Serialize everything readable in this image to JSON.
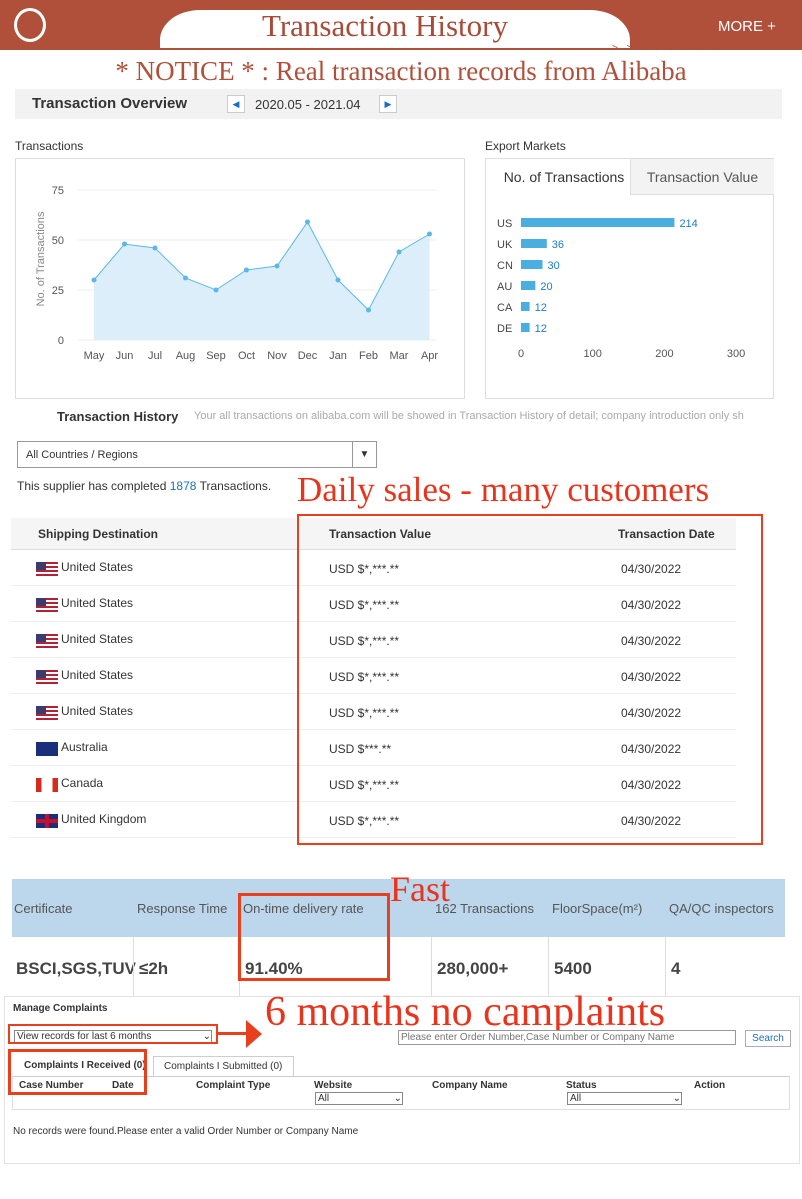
{
  "header": {
    "title": "Transaction History",
    "more": "MORE +",
    "arrows_left": "< < < < < < < < < <",
    "arrows_right": "> > > > > > > >"
  },
  "notice": "* NOTICE * : Real transaction records from Alibaba",
  "overview": {
    "title": "Transaction Overview",
    "range": "2020.05 - 2021.04"
  },
  "chart_data": [
    {
      "type": "area",
      "title": "Transactions",
      "ylabel": "No. of Transactions",
      "ylim": [
        0,
        75
      ],
      "yticks": [
        "0",
        "25",
        "50",
        "75"
      ],
      "categories": [
        "May",
        "Jun",
        "Jul",
        "Aug",
        "Sep",
        "Oct",
        "Nov",
        "Dec",
        "Jan",
        "Feb",
        "Mar",
        "Apr"
      ],
      "values": [
        30,
        48,
        46,
        31,
        25,
        35,
        37,
        59,
        30,
        15,
        44,
        53
      ],
      "color": "#5bb8e6"
    },
    {
      "type": "bar",
      "title": "Export Markets",
      "tabs": [
        "No. of Transactions",
        "Transaction Value"
      ],
      "categories": [
        "US",
        "UK",
        "CN",
        "AU",
        "CA",
        "DE"
      ],
      "values": [
        214,
        36,
        30,
        20,
        12,
        12
      ],
      "xlim": [
        0,
        300
      ],
      "xticks": [
        "0",
        "100",
        "200",
        "300"
      ],
      "color": "#4aaee0"
    }
  ],
  "history": {
    "title": "Transaction History",
    "desc": "Your all transactions on alibaba.com will be showed in Transaction History of detail; company introduction only sh",
    "filter": "All Countries / Regions",
    "completed_pre": "This supplier has completed ",
    "completed_count": "1878",
    "completed_post": " Transactions."
  },
  "annotations": {
    "daily": "Daily sales - many customers",
    "fast": "Fast",
    "no_complaints": "6 months no camplaints"
  },
  "table": {
    "headers": [
      "Shipping Destination",
      "Transaction Value",
      "Transaction Date"
    ],
    "rows": [
      {
        "country": "United States",
        "flag": "us",
        "value": "USD $*,***.**",
        "date": "04/30/2022"
      },
      {
        "country": "United States",
        "flag": "us",
        "value": "USD $*,***.**",
        "date": "04/30/2022"
      },
      {
        "country": "United States",
        "flag": "us",
        "value": "USD $*,***.**",
        "date": "04/30/2022"
      },
      {
        "country": "United States",
        "flag": "us",
        "value": "USD $*,***.**",
        "date": "04/30/2022"
      },
      {
        "country": "United States",
        "flag": "us",
        "value": "USD $*,***.**",
        "date": "04/30/2022"
      },
      {
        "country": "Australia",
        "flag": "au",
        "value": "USD $***.**",
        "date": "04/30/2022"
      },
      {
        "country": "Canada",
        "flag": "ca",
        "value": "USD $*,***.**",
        "date": "04/30/2022"
      },
      {
        "country": "United Kingdom",
        "flag": "uk",
        "value": "USD $*,***.**",
        "date": "04/30/2022"
      }
    ]
  },
  "stats": {
    "headers": [
      "Certificate",
      "Response Time",
      "On-time delivery rate",
      "162 Transactions",
      "FloorSpace(m²)",
      "QA/QC inspectors"
    ],
    "values": [
      "BSCI,SGS,TUV",
      "≤2h",
      "91.40%",
      "280,000+",
      "5400",
      "4"
    ]
  },
  "complaints": {
    "title": "Manage Complaints",
    "period": "View records for last 6 months",
    "search_placeholder": "Please enter Order Number,Case Number or Company Name",
    "search": "Search",
    "tabs": [
      "Complaints I Received (0)",
      "Complaints I Submitted (0)"
    ],
    "columns": [
      "Case Number",
      "Date",
      "Complaint Type",
      "Website",
      "Company Name",
      "Status",
      "Action"
    ],
    "website_filter": "All",
    "status_filter": "All",
    "empty": "No records were found.Please enter a valid Order Number or Company Name"
  }
}
